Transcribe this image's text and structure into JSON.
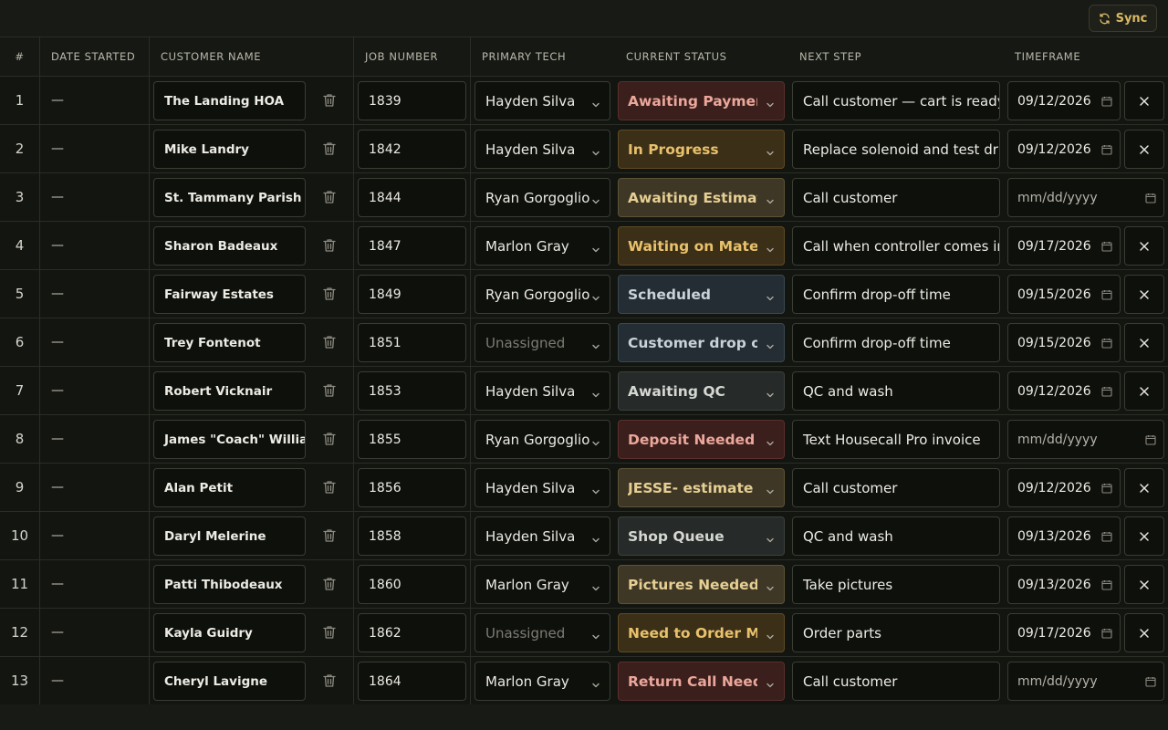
{
  "toolbar": {
    "sync_label": "Sync"
  },
  "columns": {
    "num": "#",
    "date_started": "DATE STARTED",
    "customer_name": "CUSTOMER NAME",
    "job_number": "JOB NUMBER",
    "primary_tech": "PRIMARY TECH",
    "current_status": "CURRENT STATUS",
    "next_step": "NEXT STEP",
    "timeframe": "TIMEFRAME"
  },
  "rows": [
    {
      "num": "1",
      "date_started": "—",
      "customer": "The Landing HOA",
      "job": "1839",
      "tech": "Hayden Silva",
      "status": "Awaiting Payment",
      "status_tone": "red",
      "next_step": "Call customer — cart is ready",
      "timeframe": "09/12/2026",
      "has_clear": true
    },
    {
      "num": "2",
      "date_started": "—",
      "customer": "Mike Landry",
      "job": "1842",
      "tech": "Hayden Silva",
      "status": "In Progress",
      "status_tone": "amber",
      "next_step": "Replace solenoid and test drive",
      "timeframe": "09/12/2026",
      "has_clear": true
    },
    {
      "num": "3",
      "date_started": "—",
      "customer": "St. Tammany Parish",
      "job": "1844",
      "tech": "Ryan Gorgoglione",
      "status": "Awaiting Estimate",
      "status_tone": "tan",
      "next_step": "Call customer",
      "timeframe": "mm/dd/yyyy",
      "has_clear": false
    },
    {
      "num": "4",
      "date_started": "—",
      "customer": "Sharon Badeaux",
      "job": "1847",
      "tech": "Marlon Gray",
      "status": "Waiting on Materials",
      "status_tone": "amber",
      "next_step": "Call when controller comes in",
      "timeframe": "09/17/2026",
      "has_clear": true
    },
    {
      "num": "5",
      "date_started": "—",
      "customer": "Fairway Estates",
      "job": "1849",
      "tech": "Ryan Gorgoglione",
      "status": "Scheduled",
      "status_tone": "blue",
      "next_step": "Confirm drop-off time",
      "timeframe": "09/15/2026",
      "has_clear": true
    },
    {
      "num": "6",
      "date_started": "—",
      "customer": "Trey Fontenot",
      "job": "1851",
      "tech": "Unassigned",
      "status": "Customer drop off",
      "status_tone": "blue",
      "next_step": "Confirm drop-off time",
      "timeframe": "09/15/2026",
      "has_clear": true
    },
    {
      "num": "7",
      "date_started": "—",
      "customer": "Robert Vicknair",
      "job": "1853",
      "tech": "Hayden Silva",
      "status": "Awaiting QC",
      "status_tone": "gray",
      "next_step": "QC and wash",
      "timeframe": "09/12/2026",
      "has_clear": true
    },
    {
      "num": "8",
      "date_started": "—",
      "customer": "James \"Coach\" Williams",
      "job": "1855",
      "tech": "Ryan Gorgoglione",
      "status": "Deposit Needed",
      "status_tone": "red",
      "next_step": "Text Housecall Pro invoice",
      "timeframe": "mm/dd/yyyy",
      "has_clear": false
    },
    {
      "num": "9",
      "date_started": "—",
      "customer": "Alan Petit",
      "job": "1856",
      "tech": "Hayden Silva",
      "status": "JESSE- estimate needed",
      "status_tone": "tan",
      "next_step": "Call customer",
      "timeframe": "09/12/2026",
      "has_clear": true
    },
    {
      "num": "10",
      "date_started": "—",
      "customer": "Daryl Melerine",
      "job": "1858",
      "tech": "Hayden Silva",
      "status": "Shop Queue",
      "status_tone": "gray",
      "next_step": "QC and wash",
      "timeframe": "09/13/2026",
      "has_clear": true
    },
    {
      "num": "11",
      "date_started": "—",
      "customer": "Patti Thibodeaux",
      "job": "1860",
      "tech": "Marlon Gray",
      "status": "Pictures Needed",
      "status_tone": "tan",
      "next_step": "Take pictures",
      "timeframe": "09/13/2026",
      "has_clear": true
    },
    {
      "num": "12",
      "date_started": "—",
      "customer": "Kayla Guidry",
      "job": "1862",
      "tech": "Unassigned",
      "status": "Need to Order Materials",
      "status_tone": "amber",
      "next_step": "Order parts",
      "timeframe": "09/17/2026",
      "has_clear": true
    },
    {
      "num": "13",
      "date_started": "—",
      "customer": "Cheryl Lavigne",
      "job": "1864",
      "tech": "Marlon Gray",
      "status": "Return Call Needed",
      "status_tone": "red",
      "next_step": "Call customer",
      "timeframe": "mm/dd/yyyy",
      "has_clear": false
    }
  ],
  "colors": {
    "background": "#141711",
    "accent": "#d9b964",
    "status_red": "#eba79b",
    "status_amber": "#e8c16c",
    "status_tan": "#e6cf93",
    "status_blue": "#c9d2d8",
    "status_gray": "#d5d7d2"
  },
  "icons": {
    "sync": "refresh-icon",
    "delete": "trash-icon",
    "dropdown": "chevron-down-icon",
    "date": "calendar-icon",
    "clear": "close-icon"
  }
}
